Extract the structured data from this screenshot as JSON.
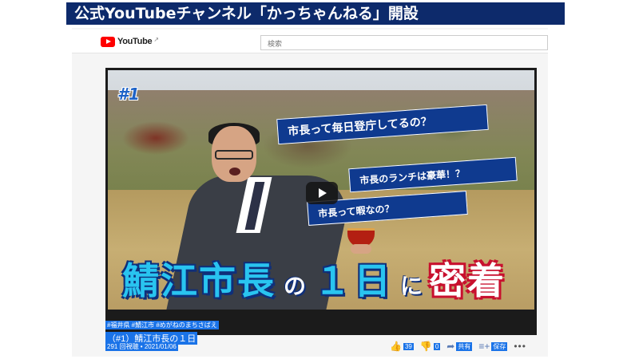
{
  "slide": {
    "title": "公式YouTubeチャンネル「かっちゃんねる」開設"
  },
  "youtube": {
    "logo_text": "YouTube",
    "search_placeholder": "検索"
  },
  "thumbnail": {
    "episode": "#1",
    "banners": [
      "市長って毎日登庁してるの？",
      "市長のランチは豪華！？",
      "市長って暇なの？"
    ],
    "headline": {
      "main": "鯖江市長",
      "no": "の",
      "day": "１日",
      "ni": "に",
      "red": "密着"
    }
  },
  "video": {
    "hashtags": "#福井県 #鯖江市 #めがねのまちさばえ",
    "title": "（#1）鯖江市長の１日",
    "views": "291 回視聴 • 2021/01/06",
    "likes": "39",
    "dislikes": "0",
    "share": "共有",
    "save": "保存"
  }
}
